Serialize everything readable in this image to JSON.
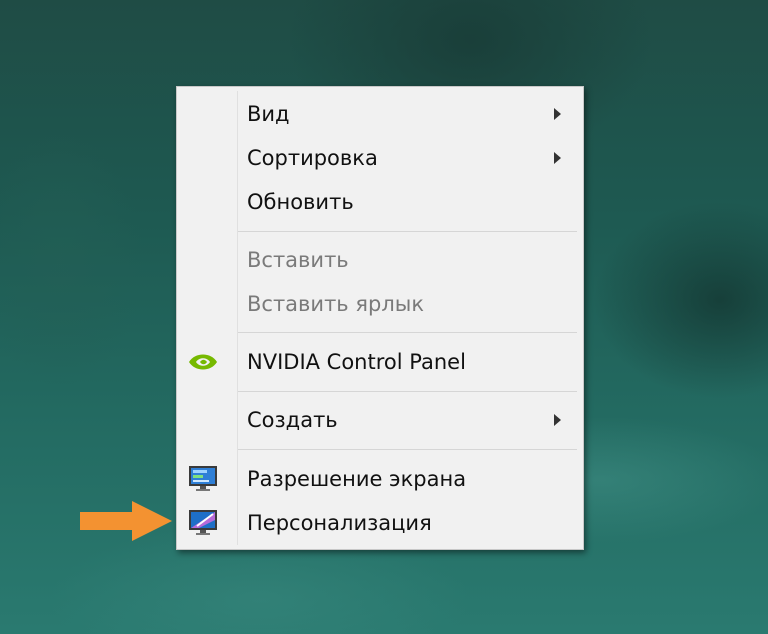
{
  "context_menu": {
    "items": [
      {
        "label": "Вид",
        "submenu": true,
        "enabled": true
      },
      {
        "label": "Сортировка",
        "submenu": true,
        "enabled": true
      },
      {
        "label": "Обновить",
        "submenu": false,
        "enabled": true
      },
      {
        "label": "Вставить",
        "submenu": false,
        "enabled": false
      },
      {
        "label": "Вставить ярлык",
        "submenu": false,
        "enabled": false
      },
      {
        "label": "NVIDIA Control Panel",
        "submenu": false,
        "enabled": true,
        "icon": "nvidia-icon"
      },
      {
        "label": "Создать",
        "submenu": true,
        "enabled": true
      },
      {
        "label": "Разрешение экрана",
        "submenu": false,
        "enabled": true,
        "icon": "screen-resolution-icon"
      },
      {
        "label": "Персонализация",
        "submenu": false,
        "enabled": true,
        "icon": "personalization-icon",
        "highlighted_by_arrow": true
      }
    ]
  },
  "colors": {
    "arrow_accent": "#f39231",
    "nvidia_green": "#76b900",
    "menu_bg": "#f1f1f1"
  }
}
